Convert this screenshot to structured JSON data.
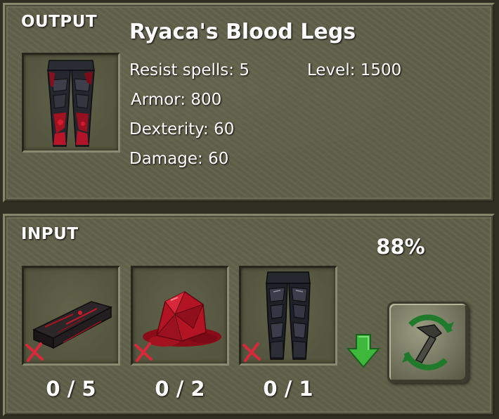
{
  "output": {
    "title": "OUTPUT",
    "item_name": "Ryaca's Blood Legs",
    "item_icon": "blood-legs-icon",
    "stats": {
      "resist_spells": {
        "label": "Resist spells:",
        "value": "5"
      },
      "level": {
        "label": "Level:",
        "value": "1500"
      },
      "armor": {
        "label": "Armor:",
        "value": "800"
      },
      "dexterity": {
        "label": "Dexterity:",
        "value": "60"
      },
      "damage": {
        "label": "Damage:",
        "value": "60"
      }
    }
  },
  "input": {
    "title": "INPUT",
    "progress_text": "88%",
    "progress": 0.88,
    "items": [
      {
        "icon": "blood-ingot-icon",
        "count_text": "0 / 5",
        "have": 0,
        "need": 5,
        "missing": true
      },
      {
        "icon": "blood-gem-icon",
        "count_text": "0 / 2",
        "have": 0,
        "need": 2,
        "missing": true
      },
      {
        "icon": "dark-legs-icon",
        "count_text": "0 / 1",
        "have": 0,
        "need": 1,
        "missing": true
      }
    ],
    "craft_button_icon": "hammer-craft-icon",
    "arrow_icon": "green-down-arrow-icon"
  },
  "colors": {
    "panel_bg": "#5f6049",
    "slot_bg": "#55563f",
    "text": "#ffffff",
    "missing_mark": "#d8283a",
    "arrow": "#3db83a"
  }
}
